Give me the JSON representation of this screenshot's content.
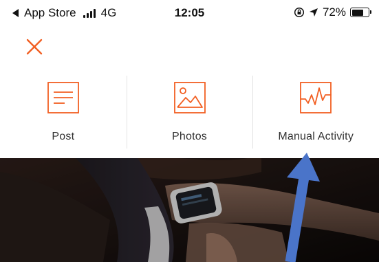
{
  "status_bar": {
    "back_label": "App Store",
    "network": "4G",
    "time": "12:05",
    "battery_percent": "72%",
    "battery_level": 0.72
  },
  "icons": {
    "close": "close-icon",
    "post": "document-lines-icon",
    "photos": "image-icon",
    "manual_activity": "activity-wave-icon"
  },
  "actions": [
    {
      "label": "Post"
    },
    {
      "label": "Photos"
    },
    {
      "label": "Manual Activity"
    }
  ],
  "colors": {
    "accent": "#f25f22",
    "annotation_arrow": "#4a74c9"
  }
}
